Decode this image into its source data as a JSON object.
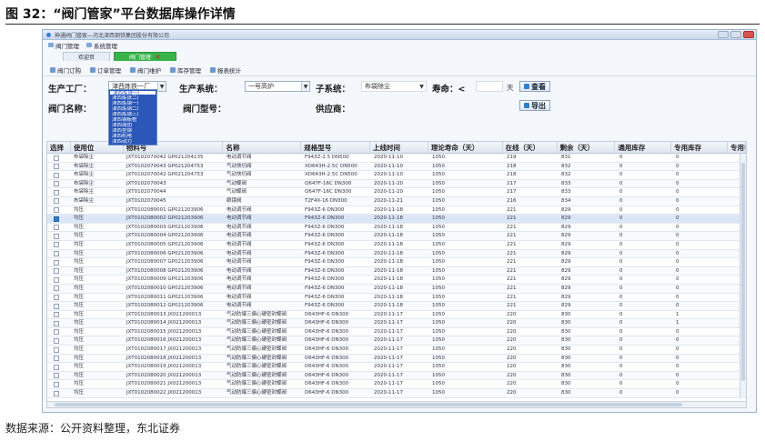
{
  "figure": {
    "title": "图 32：“阀门管家”平台数据库操作详情",
    "source": "数据来源：公开资料整理，东北证券"
  },
  "window": {
    "title": "神通阀门管家—河北津西钢铁集团股份有限公司"
  },
  "menu": {
    "items": [
      "阀门管理",
      "系统管理"
    ]
  },
  "tabs": [
    {
      "label": "欢迎页",
      "active": false
    },
    {
      "label": "阀门管理",
      "active": true
    }
  ],
  "toolbar": {
    "items": [
      "阀门订购",
      "订单管理",
      "阀门维护",
      "库存管理",
      "报表统计"
    ]
  },
  "filters": {
    "factory_label": "生产工厂：",
    "factory_value": "津西炼铁一厂",
    "system_label": "生产系统：",
    "system_value": "一号高炉",
    "subsystem_label": "子系统：",
    "subsystem_value": "布袋除尘",
    "life_label": "寿命：<",
    "life_unit": "天",
    "query_button": "查看",
    "valve_name_label": "阀门名称：",
    "valve_model_label": "阀门型号：",
    "supplier_label": "供应商：",
    "export_button": "导出",
    "dropdown_options": [
      "津西炼铁一厂",
      "津西炼铁二厂",
      "津西炼钢一厂",
      "津西炼钢二厂",
      "津西炼钢三厂",
      "津西钢板桩",
      "津西球团",
      "津西型钢",
      "津西机电",
      "津西动力"
    ]
  },
  "table": {
    "columns": [
      "选择",
      "使用位",
      "物料号",
      "名称",
      "规格型号",
      "上线时间",
      "理论寿命（天）",
      "在线（天）",
      "剩余（天）",
      "通用库存",
      "专用库存",
      "专用申"
    ],
    "rows": [
      {
        "use": "布袋除尘",
        "code": "JXT0102070042 GP021204135",
        "name": "电动调节阀",
        "spec": "F943Z-2.5 DN500",
        "date": "2020-11-10",
        "life": "1050",
        "online": "219",
        "remain": "831",
        "gen": "0",
        "spec_stock": "0",
        "sel": false
      },
      {
        "use": "布袋除尘",
        "code": "JXT0102070043 GP021204753",
        "name": "气动快切阀",
        "spec": "XD643H-2.5C DN500",
        "date": "2020-11-10",
        "life": "1050",
        "online": "218",
        "remain": "832",
        "gen": "0",
        "spec_stock": "0",
        "sel": false
      },
      {
        "use": "布袋除尘",
        "code": "JXT0102070042 GP021204753",
        "name": "气动快切阀",
        "spec": "XD643H-2.5C DN500",
        "date": "2020-11-10",
        "life": "1050",
        "online": "218",
        "remain": "832",
        "gen": "0",
        "spec_stock": "0",
        "sel": false
      },
      {
        "use": "布袋除尘",
        "code": "JXT0102070043",
        "name": "气动蝶阀",
        "spec": "Q647F-16C DN300",
        "date": "2020-11-20",
        "life": "1050",
        "online": "217",
        "remain": "833",
        "gen": "0",
        "spec_stock": "0",
        "sel": false
      },
      {
        "use": "布袋除尘",
        "code": "JXT0102070044",
        "name": "气动蝶阀",
        "spec": "Q647F-16C DN300",
        "date": "2020-11-20",
        "life": "1050",
        "online": "217",
        "remain": "833",
        "gen": "0",
        "spec_stock": "0",
        "sel": false
      },
      {
        "use": "布袋除尘",
        "code": "JXT0102070045",
        "name": "眼镜阀",
        "spec": "T2F4X-16 DN300",
        "date": "2020-11-21",
        "life": "1050",
        "online": "216",
        "remain": "834",
        "gen": "0",
        "spec_stock": "0",
        "sel": false
      },
      {
        "use": "均压",
        "code": "JXT0102080001 GP021203906",
        "name": "电动调节阀",
        "spec": "F943Z-6 DN300",
        "date": "2020-11-18",
        "life": "1050",
        "online": "221",
        "remain": "829",
        "gen": "0",
        "spec_stock": "0",
        "sel": false
      },
      {
        "use": "均压",
        "code": "JXT0102080002 GP021203906",
        "name": "电动调节阀",
        "spec": "F943Z-6 DN300",
        "date": "2020-11-18",
        "life": "1050",
        "online": "221",
        "remain": "829",
        "gen": "0",
        "spec_stock": "0",
        "sel": true
      },
      {
        "use": "均压",
        "code": "JXT0102080003 GP021203906",
        "name": "电动调节阀",
        "spec": "F943Z-6 DN300",
        "date": "2020-11-18",
        "life": "1050",
        "online": "221",
        "remain": "829",
        "gen": "0",
        "spec_stock": "0",
        "sel": false
      },
      {
        "use": "均压",
        "code": "JXT0102080004 GP021203906",
        "name": "电动调节阀",
        "spec": "F943Z-6 DN300",
        "date": "2020-11-18",
        "life": "1050",
        "online": "221",
        "remain": "829",
        "gen": "0",
        "spec_stock": "0",
        "sel": false
      },
      {
        "use": "均压",
        "code": "JXT0102080005 GP021203906",
        "name": "电动调节阀",
        "spec": "F943Z-6 DN300",
        "date": "2020-11-18",
        "life": "1050",
        "online": "221",
        "remain": "829",
        "gen": "0",
        "spec_stock": "0",
        "sel": false
      },
      {
        "use": "均压",
        "code": "JXT0102080006 GP021203906",
        "name": "电动调节阀",
        "spec": "F943Z-6 DN300",
        "date": "2020-11-18",
        "life": "1050",
        "online": "221",
        "remain": "829",
        "gen": "0",
        "spec_stock": "0",
        "sel": false
      },
      {
        "use": "均压",
        "code": "JXT0102080007 GP021203906",
        "name": "电动调节阀",
        "spec": "F943Z-6 DN300",
        "date": "2020-11-18",
        "life": "1050",
        "online": "221",
        "remain": "829",
        "gen": "0",
        "spec_stock": "0",
        "sel": false
      },
      {
        "use": "均压",
        "code": "JXT0102080008 GP021203906",
        "name": "电动调节阀",
        "spec": "F943Z-6 DN300",
        "date": "2020-11-18",
        "life": "1050",
        "online": "221",
        "remain": "829",
        "gen": "0",
        "spec_stock": "0",
        "sel": false
      },
      {
        "use": "均压",
        "code": "JXT0102080009 GP021203906",
        "name": "电动调节阀",
        "spec": "F943Z-6 DN300",
        "date": "2020-11-18",
        "life": "1050",
        "online": "221",
        "remain": "829",
        "gen": "0",
        "spec_stock": "0",
        "sel": false
      },
      {
        "use": "均压",
        "code": "JXT0102080010 GP021203906",
        "name": "电动调节阀",
        "spec": "F943Z-6 DN300",
        "date": "2020-11-18",
        "life": "1050",
        "online": "221",
        "remain": "829",
        "gen": "0",
        "spec_stock": "0",
        "sel": false
      },
      {
        "use": "均压",
        "code": "JXT0102080011 GP021203906",
        "name": "电动调节阀",
        "spec": "F943Z-6 DN300",
        "date": "2020-11-18",
        "life": "1050",
        "online": "221",
        "remain": "829",
        "gen": "0",
        "spec_stock": "0",
        "sel": false
      },
      {
        "use": "均压",
        "code": "JXT0102080012 GP021203906",
        "name": "电动调节阀",
        "spec": "F943Z-6 DN300",
        "date": "2020-11-18",
        "life": "1050",
        "online": "221",
        "remain": "829",
        "gen": "0",
        "spec_stock": "0",
        "sel": false
      },
      {
        "use": "均压",
        "code": "JXT0102080013 JX021200013",
        "name": "气动防爆三偏心硬密封蝶阀",
        "spec": "D643HF-6 DN300",
        "date": "2020-11-17",
        "life": "1050",
        "online": "220",
        "remain": "830",
        "gen": "0",
        "spec_stock": "1",
        "sel": false
      },
      {
        "use": "均压",
        "code": "JXT0102080014 JX021200013",
        "name": "气动防爆三偏心硬密封蝶阀",
        "spec": "D643HF-6 DN300",
        "date": "2020-11-17",
        "life": "1050",
        "online": "220",
        "remain": "830",
        "gen": "0",
        "spec_stock": "1",
        "sel": false
      },
      {
        "use": "均压",
        "code": "JXT0102080015 JX021200013",
        "name": "气动防爆三偏心硬密封蝶阀",
        "spec": "D643HF-6 DN300",
        "date": "2020-11-17",
        "life": "1050",
        "online": "220",
        "remain": "830",
        "gen": "0",
        "spec_stock": "0",
        "sel": false
      },
      {
        "use": "均压",
        "code": "JXT0102080016 JX021200013",
        "name": "气动防爆三偏心硬密封蝶阀",
        "spec": "D643HF-6 DN300",
        "date": "2020-11-17",
        "life": "1050",
        "online": "220",
        "remain": "830",
        "gen": "0",
        "spec_stock": "0",
        "sel": false
      },
      {
        "use": "均压",
        "code": "JXT0102080017 JX021200013",
        "name": "气动防爆三偏心硬密封蝶阀",
        "spec": "D643HF-6 DN300",
        "date": "2020-11-17",
        "life": "1050",
        "online": "220",
        "remain": "830",
        "gen": "0",
        "spec_stock": "0",
        "sel": false
      },
      {
        "use": "均压",
        "code": "JXT0102080018 JX021200013",
        "name": "气动防爆三偏心硬密封蝶阀",
        "spec": "D643HF-6 DN300",
        "date": "2020-11-17",
        "life": "1050",
        "online": "220",
        "remain": "830",
        "gen": "0",
        "spec_stock": "0",
        "sel": false
      },
      {
        "use": "均压",
        "code": "JXT0102080019 JX021200013",
        "name": "气动防爆三偏心硬密封蝶阀",
        "spec": "D643HF-6 DN300",
        "date": "2020-11-17",
        "life": "1050",
        "online": "220",
        "remain": "830",
        "gen": "0",
        "spec_stock": "0",
        "sel": false
      },
      {
        "use": "均压",
        "code": "JXT0102080020 JX021200013",
        "name": "气动防爆三偏心硬密封蝶阀",
        "spec": "D643HF-6 DN300",
        "date": "2020-11-17",
        "life": "1050",
        "online": "220",
        "remain": "830",
        "gen": "0",
        "spec_stock": "0",
        "sel": false
      },
      {
        "use": "均压",
        "code": "JXT0102080021 JX021200013",
        "name": "气动防爆三偏心硬密封蝶阀",
        "spec": "D643HF-6 DN300",
        "date": "2020-11-17",
        "life": "1050",
        "online": "220",
        "remain": "830",
        "gen": "0",
        "spec_stock": "0",
        "sel": false
      },
      {
        "use": "均压",
        "code": "JXT0102080022 JX021200013",
        "name": "气动防爆三偏心硬密封蝶阀",
        "spec": "D643HF-6 DN300",
        "date": "2020-11-17",
        "life": "1050",
        "online": "220",
        "remain": "830",
        "gen": "0",
        "spec_stock": "0",
        "sel": false
      }
    ]
  },
  "colors": {
    "active_tab": "#37b34a",
    "dropdown_highlight": "#2a57b8",
    "accent": "#2f7fd0"
  }
}
